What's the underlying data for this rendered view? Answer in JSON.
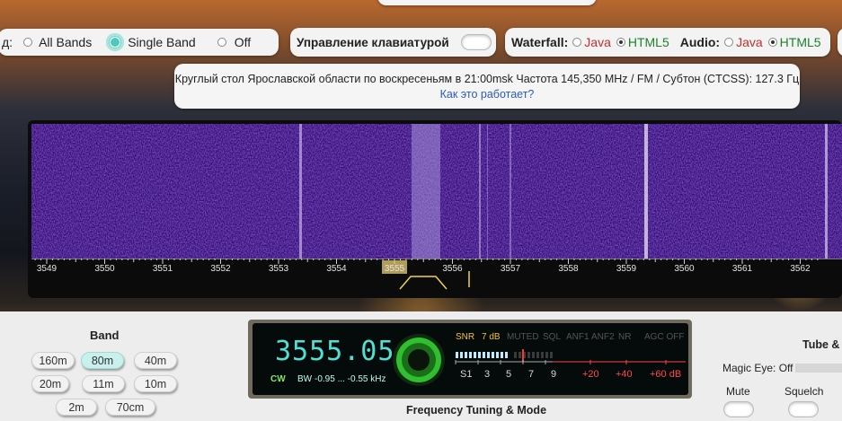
{
  "top": {
    "mode_label_fragment": "д:",
    "mode_options": [
      "All Bands",
      "Single Band",
      "Off"
    ],
    "mode_selected": "Single Band",
    "keyboard_label": "Управление клавиатурой",
    "waterfall_label": "Waterfall:",
    "waterfall_options": [
      "Java",
      "HTML5"
    ],
    "waterfall_selected": "HTML5",
    "audio_label": "Audio:",
    "audio_options": [
      "Java",
      "HTML5"
    ],
    "audio_selected": "HTML5"
  },
  "info": {
    "line1": "Круглый стол Ярославской области по воскресеньям в 21:00msk Частота 145,350 MHz / FM / Субтон (CTCSS): 127.3 Гц",
    "link": "Как это работает?"
  },
  "scale": {
    "ticks": [
      "3549",
      "3550",
      "3551",
      "3552",
      "3553",
      "3554",
      "3555",
      "3556",
      "3557",
      "3558",
      "3559",
      "3560",
      "3561",
      "3562"
    ],
    "selected": "3555"
  },
  "band": {
    "title": "Band",
    "buttons": [
      "160m",
      "80m",
      "40m",
      "20m",
      "11m",
      "10m",
      "2m",
      "70cm"
    ],
    "active": "80m"
  },
  "radio": {
    "frequency": "3555.05",
    "mode": "CW",
    "bw_label": "BW",
    "bw_value": "-0.95 ... -0.55 kHz",
    "snr_label": "SNR",
    "snr_value": "7 dB",
    "flags": [
      "MUTED",
      "SQL",
      "ANF1",
      "ANF2",
      "NR",
      "AGC OFF"
    ],
    "scale_numbers": [
      "S1",
      "3",
      "5",
      "7",
      "9",
      "+20",
      "+40",
      "+60 dB"
    ],
    "panel_title": "Frequency Tuning & Mode"
  },
  "right": {
    "title": "Tube & D",
    "magic_eye": "Magic Eye: Off",
    "mute": "Mute",
    "squelch": "Squelch"
  },
  "colors": {
    "accent": "#4fe1d3",
    "java": "#c23030",
    "html5": "#1f7f2a",
    "waterfall": "#4a1aa0"
  }
}
